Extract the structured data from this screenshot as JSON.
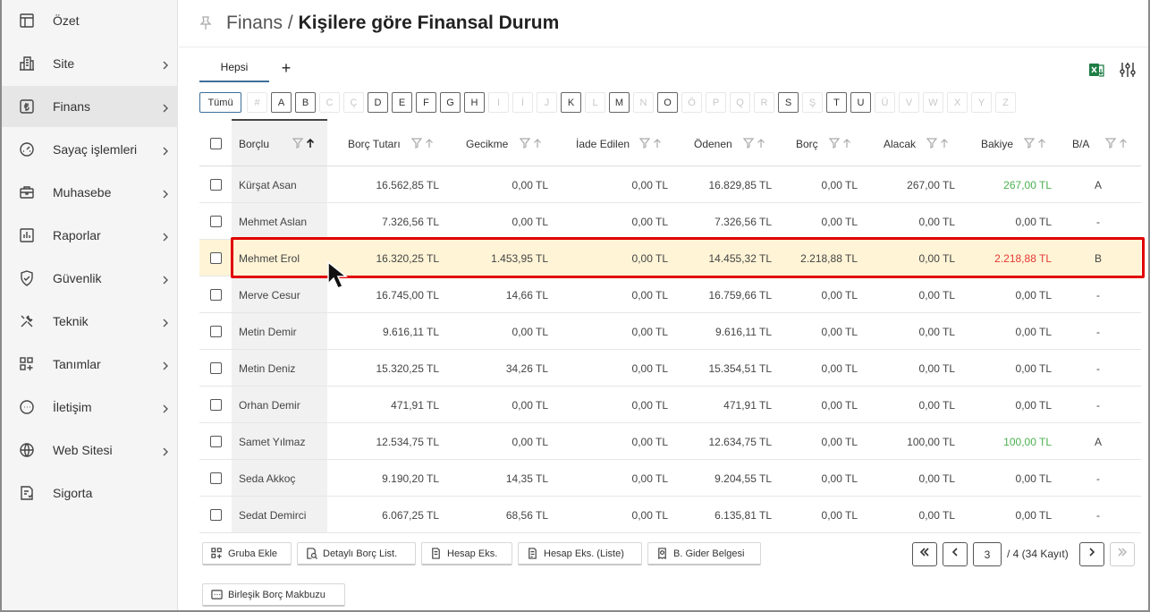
{
  "sidebar": {
    "items": [
      {
        "label": "Özet",
        "icon": "table-icon",
        "chevron": false,
        "active": false
      },
      {
        "label": "Site",
        "icon": "building-icon",
        "chevron": true,
        "active": false
      },
      {
        "label": "Finans",
        "icon": "lira-icon",
        "chevron": true,
        "active": true
      },
      {
        "label": "Sayaç işlemleri",
        "icon": "gauge-icon",
        "chevron": true,
        "active": false
      },
      {
        "label": "Muhasebe",
        "icon": "briefcase-icon",
        "chevron": true,
        "active": false
      },
      {
        "label": "Raporlar",
        "icon": "report-chart-icon",
        "chevron": true,
        "active": false
      },
      {
        "label": "Güvenlik",
        "icon": "shield-icon",
        "chevron": true,
        "active": false
      },
      {
        "label": "Teknik",
        "icon": "tools-icon",
        "chevron": true,
        "active": false
      },
      {
        "label": "Tanımlar",
        "icon": "grid-plus-icon",
        "chevron": true,
        "active": false
      },
      {
        "label": "İletişim",
        "icon": "chat-icon",
        "chevron": true,
        "active": false
      },
      {
        "label": "Web Sitesi",
        "icon": "globe-icon",
        "chevron": true,
        "active": false
      },
      {
        "label": "Sigorta",
        "icon": "insurance-icon",
        "chevron": false,
        "active": false
      }
    ]
  },
  "header": {
    "breadcrumb": "Finans",
    "separator": " / ",
    "title": "Kişilere göre Finansal Durum"
  },
  "tabs": {
    "active": "Hepsi",
    "add": "+"
  },
  "letters": {
    "all_label": "Tümü",
    "items": [
      {
        "l": "#",
        "on": false
      },
      {
        "l": "A",
        "on": true
      },
      {
        "l": "B",
        "on": true
      },
      {
        "l": "C",
        "on": false
      },
      {
        "l": "Ç",
        "on": false
      },
      {
        "l": "D",
        "on": true
      },
      {
        "l": "E",
        "on": true
      },
      {
        "l": "F",
        "on": true
      },
      {
        "l": "G",
        "on": true
      },
      {
        "l": "H",
        "on": true
      },
      {
        "l": "I",
        "on": false
      },
      {
        "l": "İ",
        "on": false
      },
      {
        "l": "J",
        "on": false
      },
      {
        "l": "K",
        "on": true
      },
      {
        "l": "L",
        "on": false
      },
      {
        "l": "M",
        "on": true
      },
      {
        "l": "N",
        "on": false
      },
      {
        "l": "O",
        "on": true
      },
      {
        "l": "Ö",
        "on": false
      },
      {
        "l": "P",
        "on": false
      },
      {
        "l": "Q",
        "on": false
      },
      {
        "l": "R",
        "on": false
      },
      {
        "l": "S",
        "on": true
      },
      {
        "l": "Ş",
        "on": false
      },
      {
        "l": "T",
        "on": true
      },
      {
        "l": "U",
        "on": true
      },
      {
        "l": "Ü",
        "on": false
      },
      {
        "l": "V",
        "on": false
      },
      {
        "l": "W",
        "on": false
      },
      {
        "l": "X",
        "on": false
      },
      {
        "l": "Y",
        "on": false
      },
      {
        "l": "Z",
        "on": false
      }
    ]
  },
  "table": {
    "columns": [
      "Borçlu",
      "Borç Tutarı",
      "Gecikme",
      "İade Edilen",
      "Ödenen",
      "Borç",
      "Alacak",
      "Bakiye",
      "B/A"
    ],
    "rows": [
      {
        "name": "Kürşat Asan",
        "borc_tutari": "16.562,85 TL",
        "gecikme": "0,00 TL",
        "iade": "0,00 TL",
        "odenen": "16.829,85 TL",
        "borc": "0,00 TL",
        "alacak": "267,00 TL",
        "bakiye": "267,00 TL",
        "ba": "A",
        "bakiye_color": "green"
      },
      {
        "name": "Mehmet Aslan",
        "borc_tutari": "7.326,56 TL",
        "gecikme": "0,00 TL",
        "iade": "0,00 TL",
        "odenen": "7.326,56 TL",
        "borc": "0,00 TL",
        "alacak": "0,00 TL",
        "bakiye": "0,00 TL",
        "ba": "-",
        "bakiye_color": "normal"
      },
      {
        "name": "Mehmet Erol",
        "borc_tutari": "16.320,25 TL",
        "gecikme": "1.453,95 TL",
        "iade": "0,00 TL",
        "odenen": "14.455,32 TL",
        "borc": "2.218,88 TL",
        "alacak": "0,00 TL",
        "bakiye": "2.218,88 TL",
        "ba": "B",
        "bakiye_color": "red",
        "highlighted": true
      },
      {
        "name": "Merve Cesur",
        "borc_tutari": "16.745,00 TL",
        "gecikme": "14,66 TL",
        "iade": "0,00 TL",
        "odenen": "16.759,66 TL",
        "borc": "0,00 TL",
        "alacak": "0,00 TL",
        "bakiye": "0,00 TL",
        "ba": "-",
        "bakiye_color": "normal"
      },
      {
        "name": "Metin Demir",
        "borc_tutari": "9.616,11 TL",
        "gecikme": "0,00 TL",
        "iade": "0,00 TL",
        "odenen": "9.616,11 TL",
        "borc": "0,00 TL",
        "alacak": "0,00 TL",
        "bakiye": "0,00 TL",
        "ba": "-",
        "bakiye_color": "normal"
      },
      {
        "name": "Metin Deniz",
        "borc_tutari": "15.320,25 TL",
        "gecikme": "34,26 TL",
        "iade": "0,00 TL",
        "odenen": "15.354,51 TL",
        "borc": "0,00 TL",
        "alacak": "0,00 TL",
        "bakiye": "0,00 TL",
        "ba": "-",
        "bakiye_color": "normal"
      },
      {
        "name": "Orhan Demir",
        "borc_tutari": "471,91 TL",
        "gecikme": "0,00 TL",
        "iade": "0,00 TL",
        "odenen": "471,91 TL",
        "borc": "0,00 TL",
        "alacak": "0,00 TL",
        "bakiye": "0,00 TL",
        "ba": "-",
        "bakiye_color": "normal"
      },
      {
        "name": "Samet Yılmaz",
        "borc_tutari": "12.534,75 TL",
        "gecikme": "0,00 TL",
        "iade": "0,00 TL",
        "odenen": "12.634,75 TL",
        "borc": "0,00 TL",
        "alacak": "100,00 TL",
        "bakiye": "100,00 TL",
        "ba": "A",
        "bakiye_color": "green"
      },
      {
        "name": "Seda Akkoç",
        "borc_tutari": "9.190,20 TL",
        "gecikme": "14,35 TL",
        "iade": "0,00 TL",
        "odenen": "9.204,55 TL",
        "borc": "0,00 TL",
        "alacak": "0,00 TL",
        "bakiye": "0,00 TL",
        "ba": "-",
        "bakiye_color": "normal"
      },
      {
        "name": "Sedat Demirci",
        "borc_tutari": "6.067,25 TL",
        "gecikme": "68,56 TL",
        "iade": "0,00 TL",
        "odenen": "6.135,81 TL",
        "borc": "0,00 TL",
        "alacak": "0,00 TL",
        "bakiye": "0,00 TL",
        "ba": "-",
        "bakiye_color": "normal"
      }
    ]
  },
  "actions": {
    "group_add": "Gruba Ekle",
    "detailed_debt_list": "Detaylı Borç List.",
    "account_statement": "Hesap Eks.",
    "account_statement_list": "Hesap Eks. (Liste)",
    "expense_document": "B. Gider Belgesi",
    "combined_receipt": "Birleşik Borç Makbuzu"
  },
  "pagination": {
    "current_page": "3",
    "info": "/ 4 (34 Kayıt)"
  },
  "colors": {
    "accent": "#3d6f99",
    "highlight_row": "#fff4d6",
    "highlight_border": "#e00000",
    "positive": "#4caf50",
    "negative": "#e53935"
  }
}
